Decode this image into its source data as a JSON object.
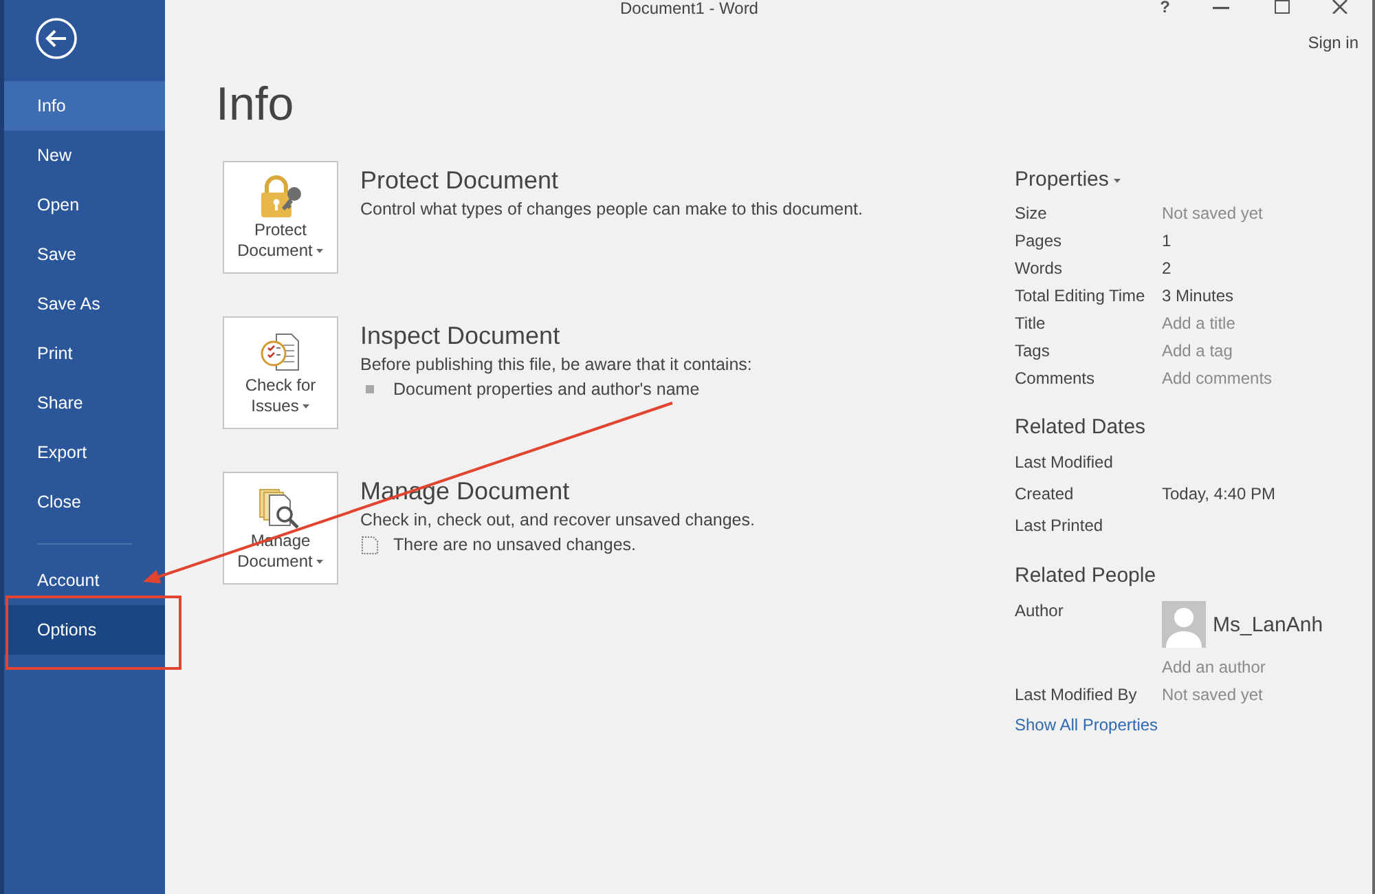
{
  "window": {
    "title": "Document1 - Word",
    "help": "?",
    "sign_in": "Sign in"
  },
  "sidebar": {
    "items": [
      {
        "label": "Info",
        "selected": true,
        "hovered": false
      },
      {
        "label": "New",
        "selected": false,
        "hovered": false
      },
      {
        "label": "Open",
        "selected": false,
        "hovered": false
      },
      {
        "label": "Save",
        "selected": false,
        "hovered": false
      },
      {
        "label": "Save As",
        "selected": false,
        "hovered": false
      },
      {
        "label": "Print",
        "selected": false,
        "hovered": false
      },
      {
        "label": "Share",
        "selected": false,
        "hovered": false
      },
      {
        "label": "Export",
        "selected": false,
        "hovered": false
      },
      {
        "label": "Close",
        "selected": false,
        "hovered": false
      }
    ],
    "bottom_items": [
      {
        "label": "Account",
        "selected": false,
        "hovered": false
      },
      {
        "label": "Options",
        "selected": false,
        "hovered": true
      }
    ]
  },
  "page": {
    "heading": "Info"
  },
  "sections": [
    {
      "kind": "protect",
      "button": "Protect Document",
      "title": "Protect Document",
      "description": "Control what types of changes people can make to this document."
    },
    {
      "kind": "inspect",
      "button": "Check for Issues",
      "title": "Inspect Document",
      "description": "Before publishing this file, be aware that it contains:",
      "notes": [
        {
          "kind": "bullet",
          "text": "Document properties and author's name"
        }
      ]
    },
    {
      "kind": "manage",
      "button": "Manage Document",
      "title": "Manage Document",
      "description": "Check in, check out, and recover unsaved changes.",
      "notes": [
        {
          "kind": "document",
          "text": "There are no unsaved changes."
        }
      ]
    }
  ],
  "properties": {
    "title": "Properties",
    "rows": [
      {
        "label": "Size",
        "value": "Not saved yet",
        "dimmed": true
      },
      {
        "label": "Pages",
        "value": "1",
        "dimmed": false
      },
      {
        "label": "Words",
        "value": "2",
        "dimmed": false
      },
      {
        "label": "Total Editing Time",
        "value": "3 Minutes",
        "dimmed": false
      },
      {
        "label": "Title",
        "placeholder": "Add a title"
      },
      {
        "label": "Tags",
        "placeholder": "Add a tag"
      },
      {
        "label": "Comments",
        "placeholder": "Add comments"
      }
    ]
  },
  "related_dates": {
    "title": "Related Dates",
    "rows": [
      {
        "label": "Last Modified"
      },
      {
        "label": "Created",
        "value": "Today, 4:40 PM",
        "dimmed": false
      },
      {
        "label": "Last Printed"
      }
    ]
  },
  "related_people": {
    "title": "Related People",
    "author_label": "Author",
    "author_name": "Ms_LanAnh",
    "author_field": {
      "placeholder": "Add an author"
    },
    "rows": [
      {
        "label": "Last Modified By",
        "value": "Not saved yet",
        "dimmed": true
      }
    ],
    "link": "Show All Properties"
  }
}
